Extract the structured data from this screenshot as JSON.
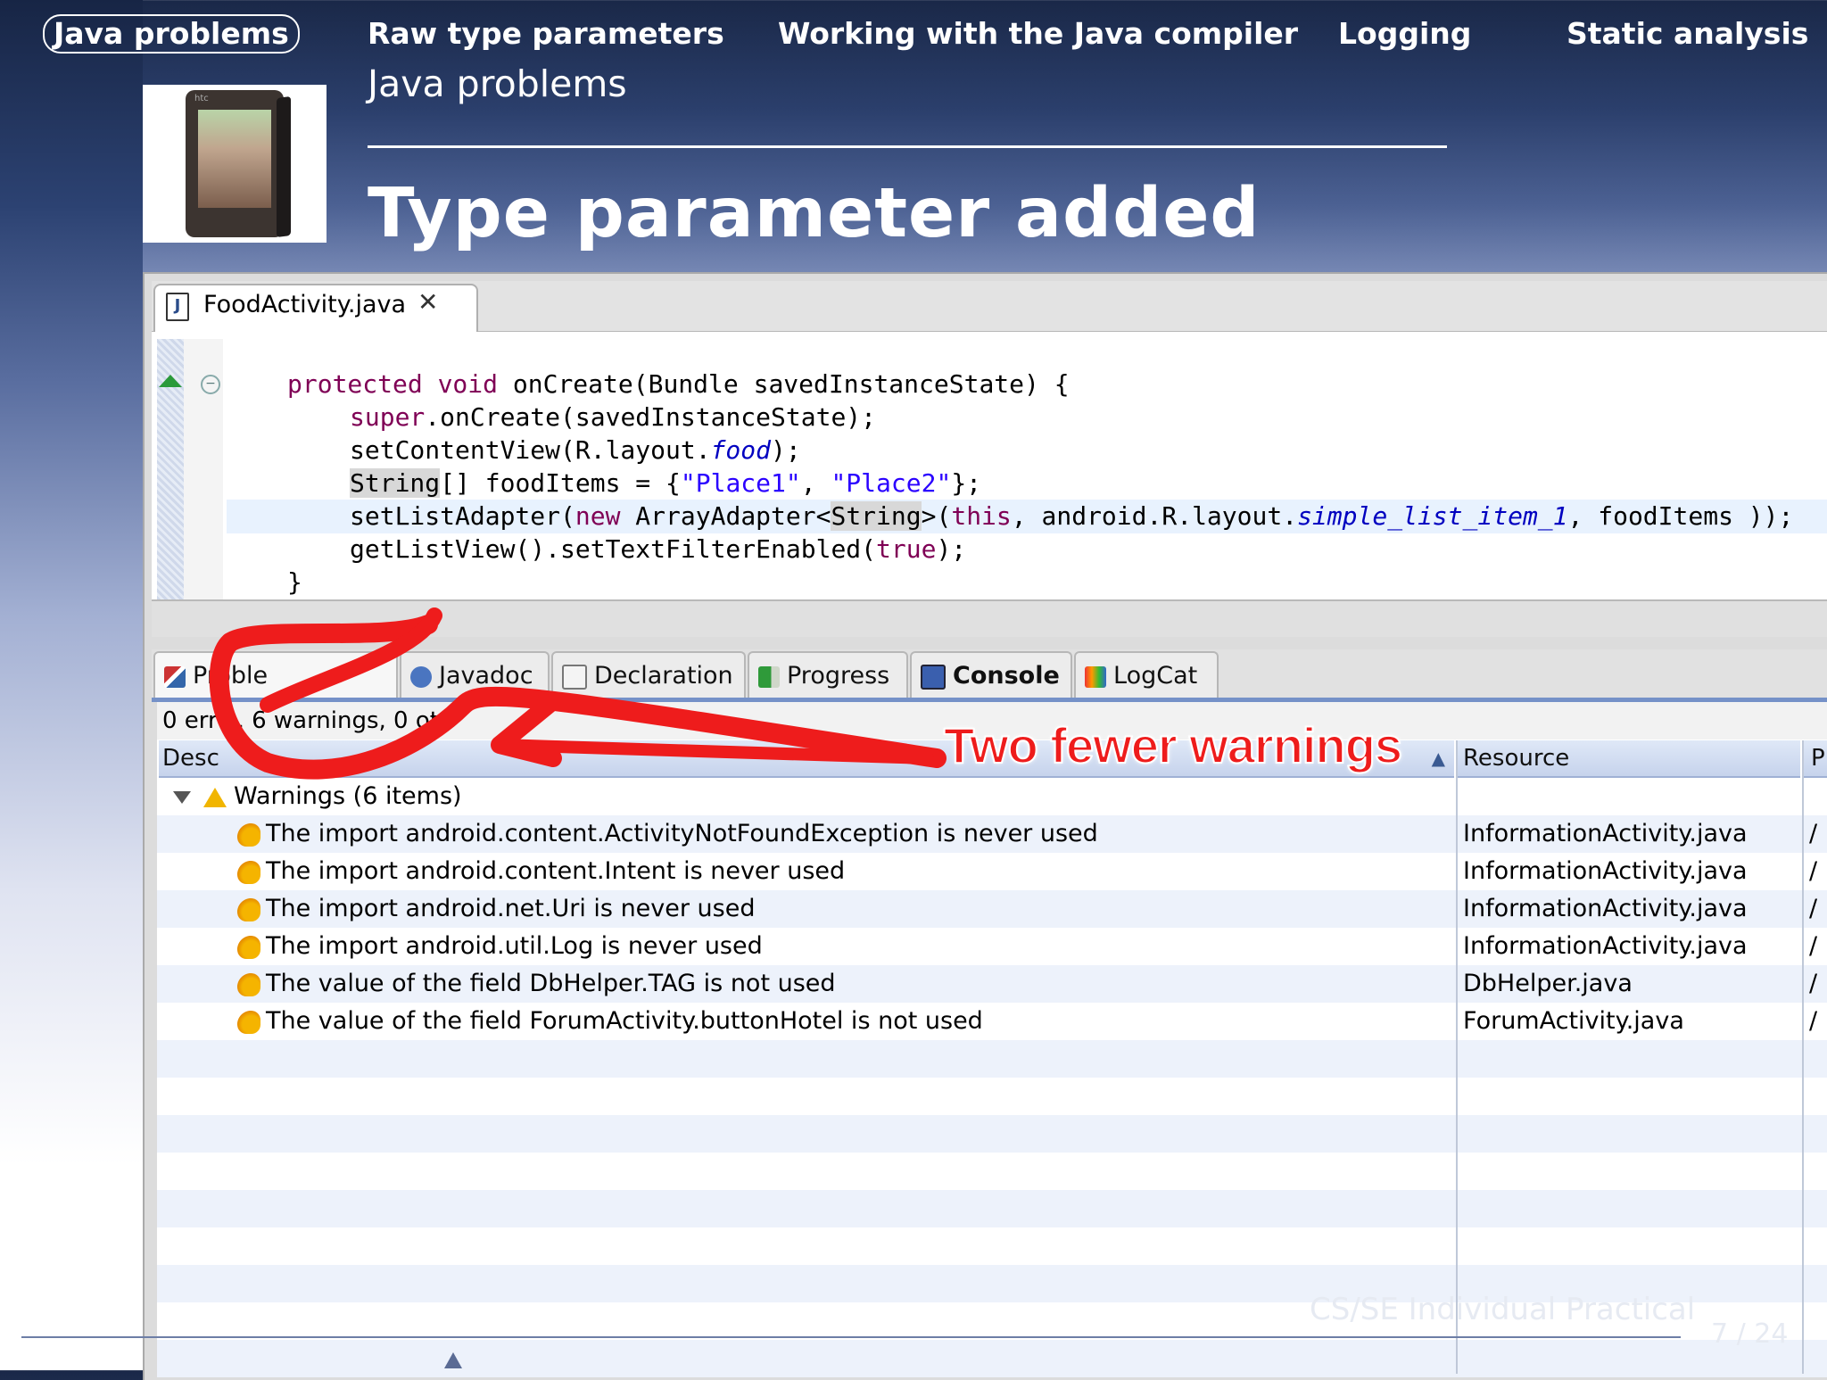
{
  "nav": {
    "items": [
      "Java problems",
      "Raw type parameters",
      "Working with the Java compiler",
      "Logging",
      "Static analysis"
    ],
    "active_index": 0
  },
  "section_title": "Java problems",
  "slide_title": "Type parameter added",
  "photo": {
    "brand": "htc"
  },
  "editor": {
    "tab_label": "FoodActivity.java",
    "tab_close_icon": "close-x-icon",
    "code_lines": [
      [
        "protected void",
        " onCreate(Bundle savedInstanceState) {"
      ],
      [
        "super",
        ".onCreate(savedInstanceState);"
      ],
      [
        "setContentView(R.layout.",
        "food",
        ");"
      ],
      [
        "String",
        "[] foodItems = {",
        "\"Place1\"",
        ", ",
        "\"Place2\"",
        "};"
      ],
      [
        "setListAdapter(",
        "new",
        " ArrayAdapter<",
        "String",
        ">(",
        "this",
        ", android.R.layout.",
        "simple_list_item_1",
        ", foodItems ));"
      ],
      [
        "getListView().setTextFilterEnabled(",
        "true",
        ");"
      ],
      [
        "}"
      ]
    ]
  },
  "views": {
    "tabs": [
      {
        "label": "Proble",
        "icon": "problems-icon"
      },
      {
        "label": "Javadoc",
        "icon": "javadoc-icon"
      },
      {
        "label": "Declaration",
        "icon": "declaration-icon"
      },
      {
        "label": "Progress",
        "icon": "progress-icon"
      },
      {
        "label": "Console",
        "icon": "console-icon"
      },
      {
        "label": "LogCat",
        "icon": "logcat-icon"
      }
    ],
    "summary": "0 err s, 6 warnings, 0 ot",
    "columns": {
      "description": "Desc",
      "resource": "Resource",
      "path": "P"
    },
    "group": "Warnings (6 items)",
    "rows": [
      {
        "description": "The import android.content.ActivityNotFoundException is never used",
        "resource": "InformationActivity.java",
        "path": "/"
      },
      {
        "description": "The import android.content.Intent is never used",
        "resource": "InformationActivity.java",
        "path": "/"
      },
      {
        "description": "The import android.net.Uri is never used",
        "resource": "InformationActivity.java",
        "path": "/"
      },
      {
        "description": "The import android.util.Log is never used",
        "resource": "InformationActivity.java",
        "path": "/"
      },
      {
        "description": "The value of the field DbHelper.TAG is not used",
        "resource": "DbHelper.java",
        "path": "/"
      },
      {
        "description": "The value of the field ForumActivity.buttonHotel is not used",
        "resource": "ForumActivity.java",
        "path": "/"
      }
    ]
  },
  "annotation": {
    "text": "Two fewer warnings",
    "color": "#ee1c1c"
  },
  "footer": {
    "course": "CS/SE Individual Practical",
    "page": "7 / 24"
  }
}
